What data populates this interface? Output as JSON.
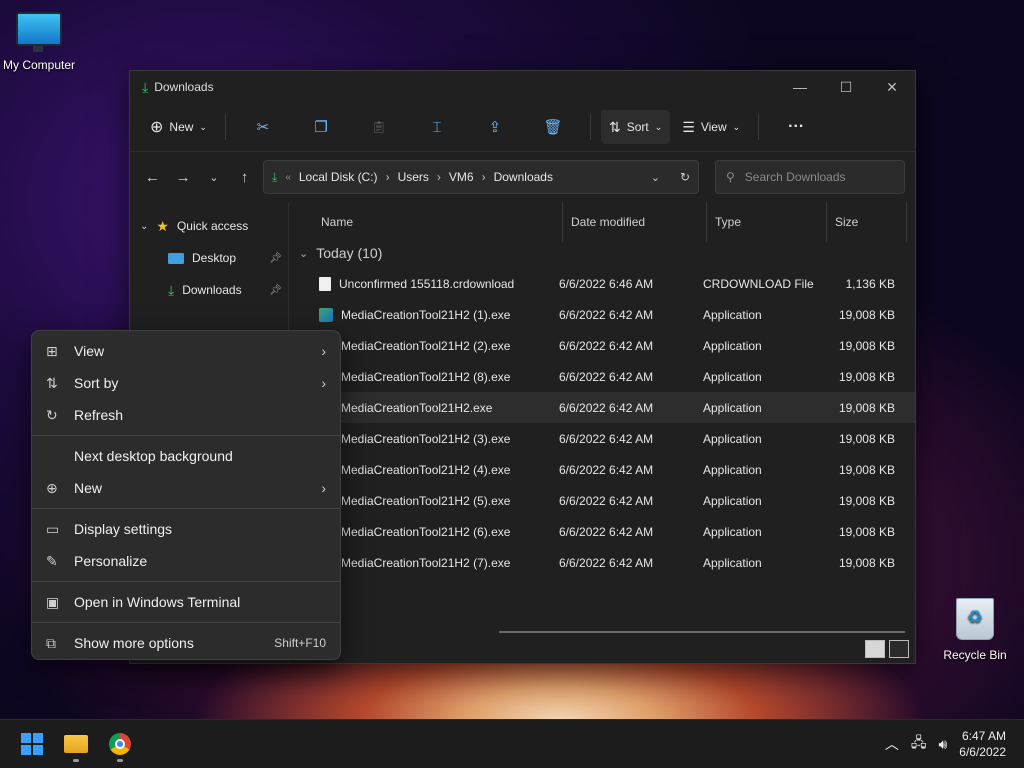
{
  "desktop": {
    "icons": [
      {
        "label": "My Computer"
      },
      {
        "label": "Recycle Bin"
      }
    ]
  },
  "explorer": {
    "title": "Downloads",
    "toolbar": {
      "new_label": "New",
      "sort_label": "Sort",
      "view_label": "View",
      "more_label": "···"
    },
    "address": {
      "crumbs": [
        "Local Disk (C:)",
        "Users",
        "VM6",
        "Downloads"
      ],
      "overflow": "«"
    },
    "search": {
      "placeholder": "Search Downloads"
    },
    "nav": {
      "items": [
        {
          "label": "Quick access"
        },
        {
          "label": "Desktop"
        },
        {
          "label": "Downloads"
        }
      ]
    },
    "columns": {
      "name": "Name",
      "date": "Date modified",
      "type": "Type",
      "size": "Size"
    },
    "group": {
      "label": "Today (10)"
    },
    "files": [
      {
        "name": "Unconfirmed 155118.crdownload",
        "date": "6/6/2022 6:46 AM",
        "type": "CRDOWNLOAD File",
        "size": "1,136 KB"
      },
      {
        "name": "MediaCreationTool21H2 (1).exe",
        "date": "6/6/2022 6:42 AM",
        "type": "Application",
        "size": "19,008 KB"
      },
      {
        "name": "MediaCreationTool21H2 (2).exe",
        "date": "6/6/2022 6:42 AM",
        "type": "Application",
        "size": "19,008 KB"
      },
      {
        "name": "MediaCreationTool21H2 (8).exe",
        "date": "6/6/2022 6:42 AM",
        "type": "Application",
        "size": "19,008 KB"
      },
      {
        "name": "MediaCreationTool21H2.exe",
        "date": "6/6/2022 6:42 AM",
        "type": "Application",
        "size": "19,008 KB"
      },
      {
        "name": "MediaCreationTool21H2 (3).exe",
        "date": "6/6/2022 6:42 AM",
        "type": "Application",
        "size": "19,008 KB"
      },
      {
        "name": "MediaCreationTool21H2 (4).exe",
        "date": "6/6/2022 6:42 AM",
        "type": "Application",
        "size": "19,008 KB"
      },
      {
        "name": "MediaCreationTool21H2 (5).exe",
        "date": "6/6/2022 6:42 AM",
        "type": "Application",
        "size": "19,008 KB"
      },
      {
        "name": "MediaCreationTool21H2 (6).exe",
        "date": "6/6/2022 6:42 AM",
        "type": "Application",
        "size": "19,008 KB"
      },
      {
        "name": "MediaCreationTool21H2 (7).exe",
        "date": "6/6/2022 6:42 AM",
        "type": "Application",
        "size": "19,008 KB"
      }
    ]
  },
  "context_menu": {
    "items": [
      {
        "label": "View"
      },
      {
        "label": "Sort by"
      },
      {
        "label": "Refresh"
      },
      {
        "label": "Next desktop background"
      },
      {
        "label": "New"
      },
      {
        "label": "Display settings"
      },
      {
        "label": "Personalize"
      },
      {
        "label": "Open in Windows Terminal"
      },
      {
        "label": "Show more options",
        "shortcut": "Shift+F10"
      }
    ]
  },
  "taskbar": {
    "time": "6:47 AM",
    "date": "6/6/2022"
  }
}
